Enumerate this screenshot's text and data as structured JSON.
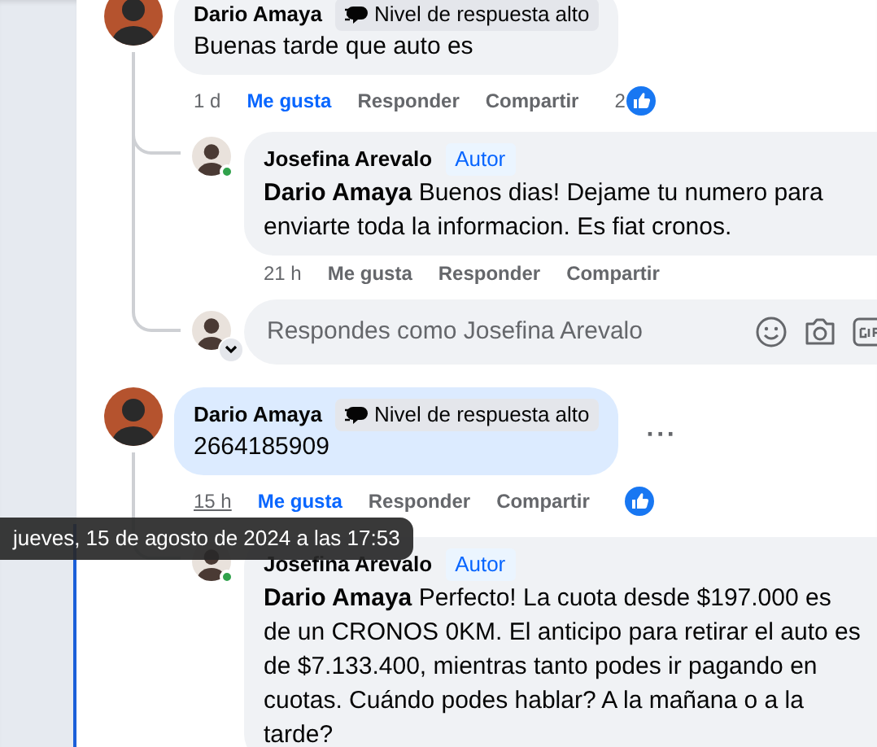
{
  "comments": [
    {
      "author": "Dario Amaya",
      "badge": "Nivel de respuesta alto",
      "text": "Buenas tarde que auto es",
      "highlighted": false,
      "more_button": false,
      "time": "1 d",
      "time_hovered": false,
      "actions": [
        {
          "label": "Me gusta",
          "selected": true
        },
        {
          "label": "Responder",
          "selected": false
        },
        {
          "label": "Compartir",
          "selected": false
        }
      ],
      "reaction_count": "2",
      "reaction_icon": true,
      "replies": [
        {
          "author": "Josefina Arevalo",
          "author_tag": "Autor",
          "online": true,
          "text": "**Dario Amaya** Buenos dias! Dejame tu numero para enviarte toda la informacion. Es fiat cronos.",
          "time": "21 h",
          "actions": [
            {
              "label": "Me gusta",
              "selected": false
            },
            {
              "label": "Responder",
              "selected": false
            },
            {
              "label": "Compartir",
              "selected": false
            }
          ]
        }
      ],
      "composer": {
        "placeholder": "Respondes como Josefina Arevalo"
      }
    },
    {
      "author": "Dario Amaya",
      "badge": "Nivel de respuesta alto",
      "text": "2664185909",
      "highlighted": true,
      "more_button": true,
      "more_label": "···",
      "time": "15 h",
      "time_hovered": true,
      "actions": [
        {
          "label": "Me gusta",
          "selected": true
        },
        {
          "label": "Responder",
          "selected": false
        },
        {
          "label": "Compartir",
          "selected": false
        }
      ],
      "reaction_icon": true,
      "replies": [
        {
          "author": "Josefina Arevalo",
          "author_tag": "Autor",
          "online": true,
          "text": "**Dario Amaya** Perfecto! La cuota desde $197.000 es de un CRONOS 0KM. El anticipo para retirar el auto es de $7.133.400, mientras tanto podes ir pagando en cuotas. Cuándo podes hablar? A la mañana o a la tarde?"
        }
      ]
    }
  ],
  "tooltip": {
    "text": "jueves, 15 de agosto de 2024 a las 17:53"
  }
}
